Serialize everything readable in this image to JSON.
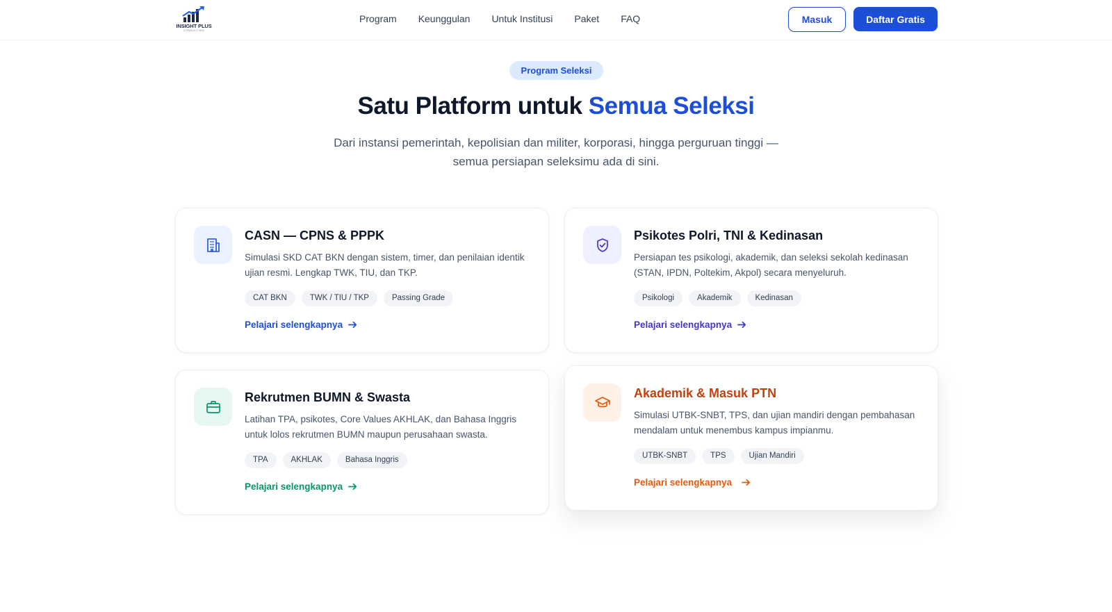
{
  "header": {
    "logo": {
      "text": "INSIGHT PLUS",
      "subtext": "CONSULTING"
    },
    "nav": [
      "Program",
      "Keunggulan",
      "Untuk Institusi",
      "Paket",
      "FAQ"
    ],
    "login_label": "Masuk",
    "signup_label": "Daftar Gratis"
  },
  "hero": {
    "badge": "Program Seleksi",
    "title_prefix": "Satu Platform untuk ",
    "title_accent": "Semua Seleksi",
    "subtitle": "Dari instansi pemerintah, kepolisian dan militer, korporasi, hingga perguruan tinggi — semua persiapan seleksimu ada di sini."
  },
  "cards": [
    {
      "icon": "building-icon",
      "title": "CASN — CPNS & PPPK",
      "description": "Simulasi SKD CAT BKN dengan sistem, timer, dan penilaian identik ujian resmi. Lengkap TWK, TIU, dan TKP.",
      "tags": [
        "CAT BKN",
        "TWK / TIU / TKP",
        "Passing Grade"
      ],
      "link": "Pelajari selengkapnya",
      "accent": "#1d4ed8",
      "icon_bg": "#eaf1ff"
    },
    {
      "icon": "shield-check-icon",
      "title": "Psikotes Polri, TNI & Kedinasan",
      "description": "Persiapan tes psikologi, akademik, dan seleksi sekolah kedinasan (STAN, IPDN, Poltekim, Akpol) secara menyeluruh.",
      "tags": [
        "Psikologi",
        "Akademik",
        "Kedinasan"
      ],
      "link": "Pelajari selengkapnya",
      "accent": "#4338ca",
      "icon_bg": "#eef0ff"
    },
    {
      "icon": "briefcase-icon",
      "title": "Rekrutmen BUMN & Swasta",
      "description": "Latihan TPA, psikotes, Core Values AKHLAK, dan Bahasa Inggris untuk lolos rekrutmen BUMN maupun perusahaan swasta.",
      "tags": [
        "TPA",
        "AKHLAK",
        "Bahasa Inggris"
      ],
      "link": "Pelajari selengkapnya",
      "accent": "#059669",
      "icon_bg": "#e7f8f0"
    },
    {
      "icon": "graduation-cap-icon",
      "title": "Akademik & Masuk PTN",
      "description": "Simulasi UTBK-SNBT, TPS, dan ujian mandiri dengan pembahasan mendalam untuk menembus kampus impianmu.",
      "tags": [
        "UTBK-SNBT",
        "TPS",
        "Ujian Mandiri"
      ],
      "link": "Pelajari selengkapnya",
      "accent": "#ea580c",
      "title_color": "#c2410c",
      "icon_bg": "#fff1e6"
    }
  ]
}
